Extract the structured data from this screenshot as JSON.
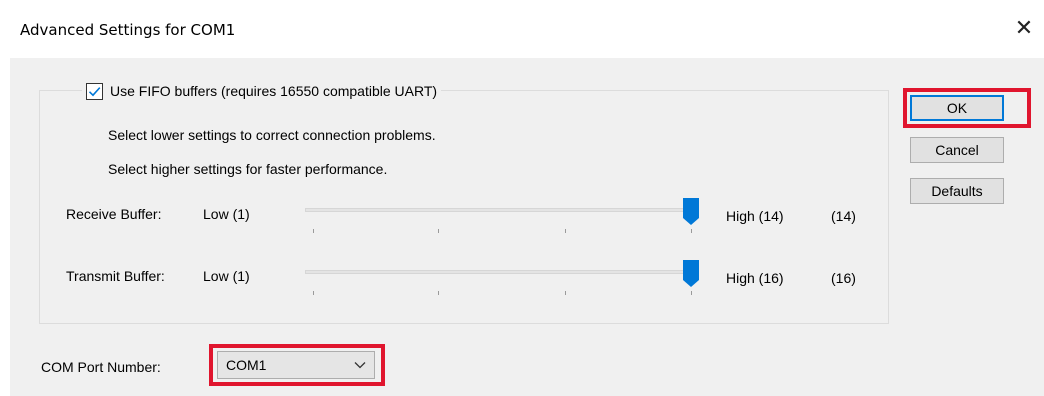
{
  "window": {
    "title": "Advanced Settings for COM1",
    "close_glyph": "✕"
  },
  "fifo": {
    "checkbox_label": "Use FIFO buffers (requires 16550 compatible UART)",
    "checked": true
  },
  "descriptions": {
    "line1": "Select lower settings to correct connection problems.",
    "line2": "Select higher settings for faster performance."
  },
  "receive_buffer": {
    "label": "Receive Buffer:",
    "low_label": "Low (1)",
    "high_label": "High (14)",
    "value_label": "(14)",
    "min": 1,
    "max": 14,
    "value": 14
  },
  "transmit_buffer": {
    "label": "Transmit Buffer:",
    "low_label": "Low (1)",
    "high_label": "High (16)",
    "value_label": "(16)",
    "min": 1,
    "max": 16,
    "value": 16
  },
  "buttons": {
    "ok_label": "OK",
    "cancel_label": "Cancel",
    "defaults_label": "Defaults"
  },
  "com_port": {
    "label": "COM Port Number:",
    "selected": "COM1"
  },
  "colors": {
    "highlight": "#e0152e",
    "accent": "#0078d7",
    "thumb": "#0078d7"
  }
}
